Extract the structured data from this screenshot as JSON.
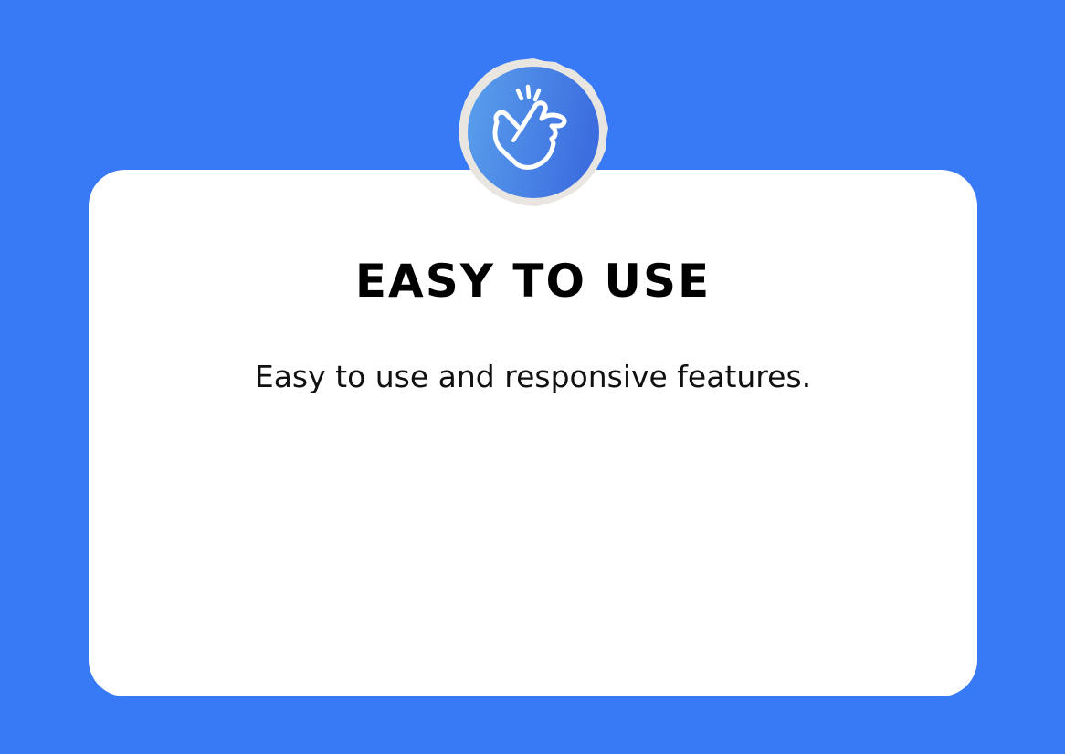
{
  "colors": {
    "background": "#3879f6",
    "card": "#ffffff",
    "badge_gradient_start": "#5aa0ec",
    "badge_gradient_end": "#3d6ee0",
    "badge_border": "#e9e6e1"
  },
  "badge": {
    "icon": "snap-finger-check-icon"
  },
  "card": {
    "title": "EASY TO USE",
    "description": "Easy to use and responsive features."
  }
}
